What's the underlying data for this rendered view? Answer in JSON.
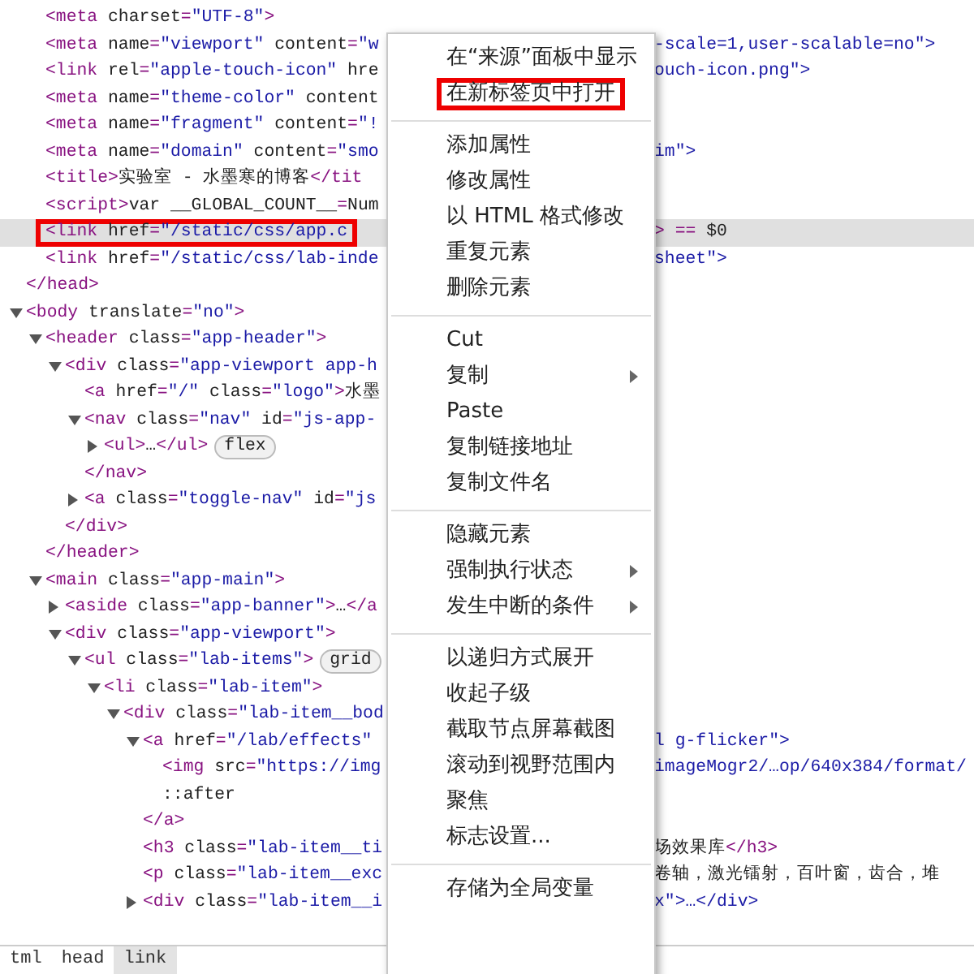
{
  "dom_tree": [
    {
      "children": [
        {
          "text": "<meta charset=\"UTF-8\">"
        },
        {
          "text": "<meta name=\"viewport\" content=\"w",
          "right": {
            "text": "-scale=1,user-scalable=no\">",
            "kind": "value"
          }
        },
        {
          "text": "<link rel=\"apple-touch-icon\" hre",
          "right": {
            "text": "ouch-icon.png\">",
            "kind": "value"
          }
        },
        {
          "text": "<meta name=\"theme-color\" content"
        },
        {
          "text": "<meta name=\"fragment\" content=\"!"
        },
        {
          "text": "<meta name=\"domain\" content=\"smo",
          "right": {
            "text": "im\">",
            "kind": "value"
          }
        },
        {
          "text": "<title>实验室 - 水墨寒的博客</tit"
        },
        {
          "text": "<script>var __GLOBAL_COUNT__=Num"
        },
        {
          "text": "<link href=\"/static/css/app.c",
          "right": {
            "text": "> == $0",
            "kind": "markup"
          },
          "selected": true,
          "highlighted": true
        },
        {
          "text": "<link href=\"/static/css/lab-inde",
          "right": {
            "text": "sheet\">",
            "kind": "value"
          }
        }
      ]
    },
    {
      "text": "</head>"
    },
    {
      "text": "<body translate=\"no\">",
      "expanded": true,
      "children": [
        {
          "text": "<header class=\"app-header\">",
          "expanded": true,
          "children": [
            {
              "text": "<div class=\"app-viewport app-h",
              "expanded": true,
              "children": [
                {
                  "text": "<a href=\"/\" class=\"logo\">水墨"
                },
                {
                  "text": "<nav class=\"nav\" id=\"js-app-",
                  "expanded": true,
                  "children": [
                    {
                      "text": "<ul>…</ul>",
                      "expanded": false,
                      "badge": "flex"
                    }
                  ]
                },
                {
                  "text": "</nav>"
                },
                {
                  "text": "<a class=\"toggle-nav\" id=\"js",
                  "expanded": false
                }
              ]
            },
            {
              "text": "</div>"
            }
          ]
        },
        {
          "text": "</header>"
        },
        {
          "text": "<main class=\"app-main\">",
          "expanded": true,
          "children": [
            {
              "text": "<aside class=\"app-banner\">…</a",
              "expanded": false
            },
            {
              "text": "<div class=\"app-viewport\">",
              "expanded": true,
              "children": [
                {
                  "text": "<ul class=\"lab-items\">",
                  "expanded": true,
                  "badge": "grid",
                  "children": [
                    {
                      "text": "<li class=\"lab-item\">",
                      "expanded": true,
                      "children": [
                        {
                          "text": "<div class=\"lab-item__bod",
                          "expanded": true,
                          "children": [
                            {
                              "text": "<a href=\"/lab/effects\"",
                              "expanded": true,
                              "right": {
                                "text": "l g-flicker\">",
                                "kind": "value"
                              },
                              "children": [
                                {
                                  "text": "<img src=\"https://img",
                                  "right": {
                                    "text": "imageMogr2/…op/640x384/format/",
                                    "kind": "value"
                                  }
                                },
                                {
                                  "text": "::after"
                                }
                              ]
                            },
                            {
                              "text": "</a>"
                            },
                            {
                              "text": "<h3 class=\"lab-item__ti",
                              "right": {
                                "text": "场效果库</h3>",
                                "kind": "content"
                              }
                            },
                            {
                              "text": "<p class=\"lab-item__exc",
                              "right": {
                                "text": "卷轴，激光镭射，百叶窗，齿合，堆",
                                "kind": "content"
                              }
                            },
                            {
                              "text": "<div class=\"lab-item__i",
                              "expanded": false,
                              "right": {
                                "text": "x\">…</div>",
                                "kind": "value"
                              }
                            }
                          ]
                        }
                      ]
                    }
                  ]
                }
              ]
            }
          ]
        }
      ]
    }
  ],
  "breadcrumbs": [
    {
      "label": "tml",
      "selected": false
    },
    {
      "label": "head",
      "selected": false
    },
    {
      "label": "link",
      "selected": true
    }
  ],
  "context_menu": {
    "groups": [
      [
        {
          "label": "在“来源”面板中显示"
        },
        {
          "label": "在新标签页中打开",
          "highlighted": true
        }
      ],
      [
        {
          "label": "添加属性"
        },
        {
          "label": "修改属性"
        },
        {
          "label": "以 HTML 格式修改"
        },
        {
          "label": "重复元素"
        },
        {
          "label": "删除元素"
        }
      ],
      [
        {
          "label": "Cut"
        },
        {
          "label": "复制",
          "submenu": true
        },
        {
          "label": "Paste"
        },
        {
          "label": "复制链接地址"
        },
        {
          "label": "复制文件名"
        }
      ],
      [
        {
          "label": "隐藏元素"
        },
        {
          "label": "强制执行状态",
          "submenu": true
        },
        {
          "label": "发生中断的条件",
          "submenu": true
        }
      ],
      [
        {
          "label": "以递归方式展开"
        },
        {
          "label": "收起子级"
        },
        {
          "label": "截取节点屏幕截图"
        },
        {
          "label": "滚动到视野范围内"
        },
        {
          "label": "聚焦"
        },
        {
          "label": "标志设置..."
        }
      ],
      [
        {
          "label": "存储为全局变量"
        }
      ]
    ]
  }
}
